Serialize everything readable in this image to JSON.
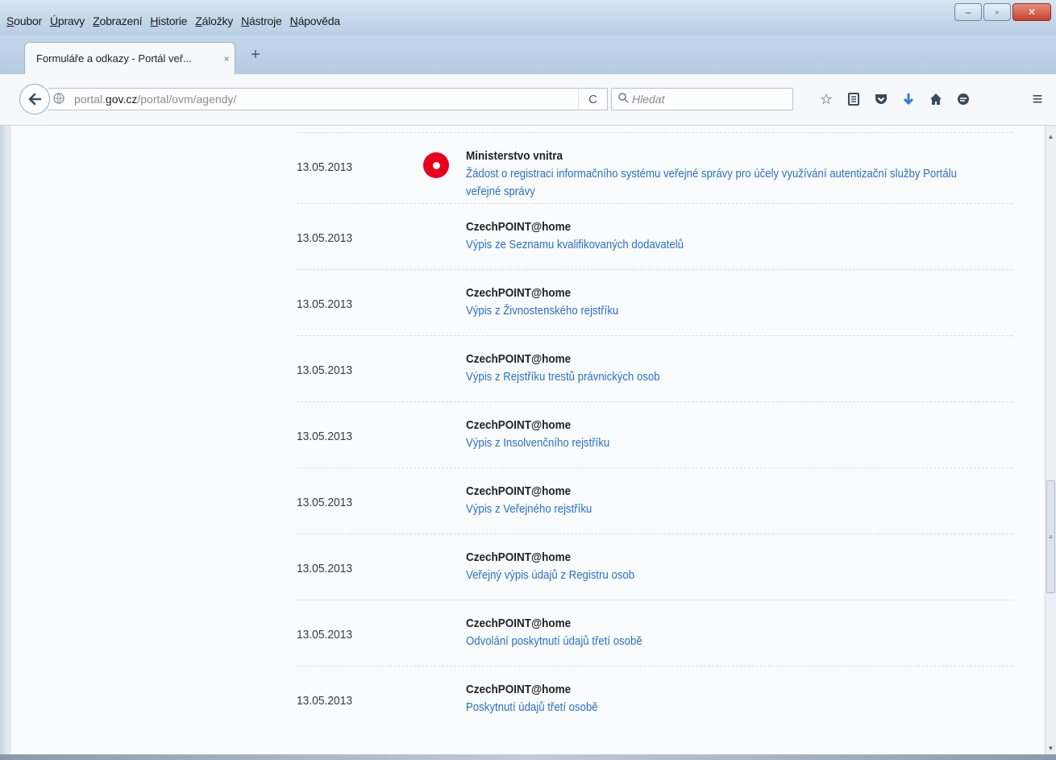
{
  "menu": [
    "Soubor",
    "Úpravy",
    "Zobrazení",
    "Historie",
    "Záložky",
    "Nástroje",
    "Nápověda"
  ],
  "window": {
    "minimize": "–",
    "maximize": "▫",
    "close": "✕"
  },
  "tab": {
    "title": "Formuláře a odkazy - Portál veř...",
    "close": "×",
    "new_tab": "+"
  },
  "nav": {
    "back": "🡐",
    "url_prefix": "portal.",
    "url_domain": "gov.cz",
    "url_path": "/portal/ovm/agendy/",
    "reload": "C",
    "search_placeholder": "Hledat"
  },
  "toolbar_icons": [
    "star-icon",
    "reading-list-icon",
    "pocket-icon",
    "download-icon",
    "home-icon",
    "chat-icon"
  ],
  "rows": [
    {
      "date": "13.05.2013",
      "org": "Ministerstvo vnitra",
      "link": "Žádost o registraci informačního systému veřejné správy pro účely využívání autentizační služby Portálu veřejné správy"
    },
    {
      "date": "13.05.2013",
      "org": "CzechPOINT@home",
      "link": "Výpis ze Seznamu kvalifikovaných dodavatelů"
    },
    {
      "date": "13.05.2013",
      "org": "CzechPOINT@home",
      "link": "Výpis z Živnostenského rejstříku"
    },
    {
      "date": "13.05.2013",
      "org": "CzechPOINT@home",
      "link": "Výpis z Rejstříku trestů právnických osob"
    },
    {
      "date": "13.05.2013",
      "org": "CzechPOINT@home",
      "link": "Výpis z Insolvenčního rejstříku"
    },
    {
      "date": "13.05.2013",
      "org": "CzechPOINT@home",
      "link": "Výpis z Veřejného rejstříku"
    },
    {
      "date": "13.05.2013",
      "org": "CzechPOINT@home",
      "link": "Veřejný výpis údajů z Registru osob"
    },
    {
      "date": "13.05.2013",
      "org": "CzechPOINT@home",
      "link": "Odvolání poskytnutí údajů třetí osobě"
    },
    {
      "date": "13.05.2013",
      "org": "CzechPOINT@home",
      "link": "Poskytnutí údajů třetí osobě"
    }
  ],
  "colors": {
    "link": "#2a70c6",
    "marker": "#e8001c"
  }
}
